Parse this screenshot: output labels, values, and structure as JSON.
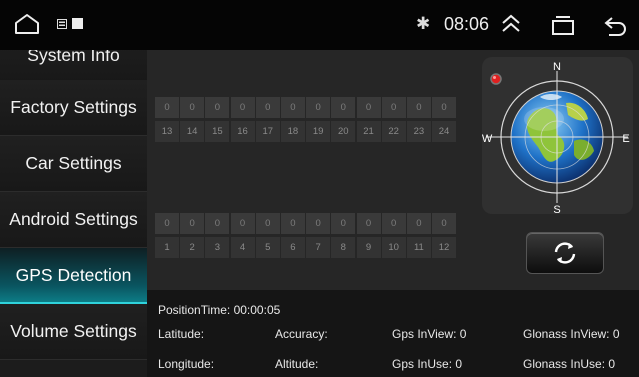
{
  "status_bar": {
    "time": "08:06",
    "bluetooth_glyph": "✱",
    "icons": [
      "home-icon",
      "notification-icon",
      "bluetooth-icon",
      "expand-up-icon",
      "recent-apps-icon",
      "back-icon"
    ]
  },
  "sidebar": {
    "items": [
      {
        "label": "System Info",
        "active": false
      },
      {
        "label": "Factory Settings",
        "active": false
      },
      {
        "label": "Car Settings",
        "active": false
      },
      {
        "label": "Android Settings",
        "active": false
      },
      {
        "label": "GPS Detection",
        "active": true
      },
      {
        "label": "Volume Settings",
        "active": false
      }
    ]
  },
  "signal_grid_top": {
    "values": [
      "0",
      "0",
      "0",
      "0",
      "0",
      "0",
      "0",
      "0",
      "0",
      "0",
      "0",
      "0"
    ],
    "labels": [
      "13",
      "14",
      "15",
      "16",
      "17",
      "18",
      "19",
      "20",
      "21",
      "22",
      "23",
      "24"
    ]
  },
  "signal_grid_bottom": {
    "values": [
      "0",
      "0",
      "0",
      "0",
      "0",
      "0",
      "0",
      "0",
      "0",
      "0",
      "0",
      "0"
    ],
    "labels": [
      "1",
      "2",
      "3",
      "4",
      "5",
      "6",
      "7",
      "8",
      "9",
      "10",
      "11",
      "12"
    ]
  },
  "compass": {
    "north": "N",
    "south": "S",
    "east": "E",
    "west": "W"
  },
  "refresh_button": {
    "icon": "refresh-icon"
  },
  "info": {
    "position_time": "PositionTime: 00:00:05",
    "latitude": "Latitude:",
    "accuracy": "Accuracy:",
    "gps_inview": "Gps InView: 0",
    "glonass_inview": "Glonass InView: 0",
    "longitude": "Longitude:",
    "altitude": "Altitude:",
    "gps_inuse": "Gps InUse: 0",
    "glonass_inuse": "Glonass InUse: 0"
  },
  "colors": {
    "active_accent": "#2fd3dc",
    "background": "#262626",
    "sidebar": "#1c1c1c",
    "status_led": "#e02020"
  }
}
